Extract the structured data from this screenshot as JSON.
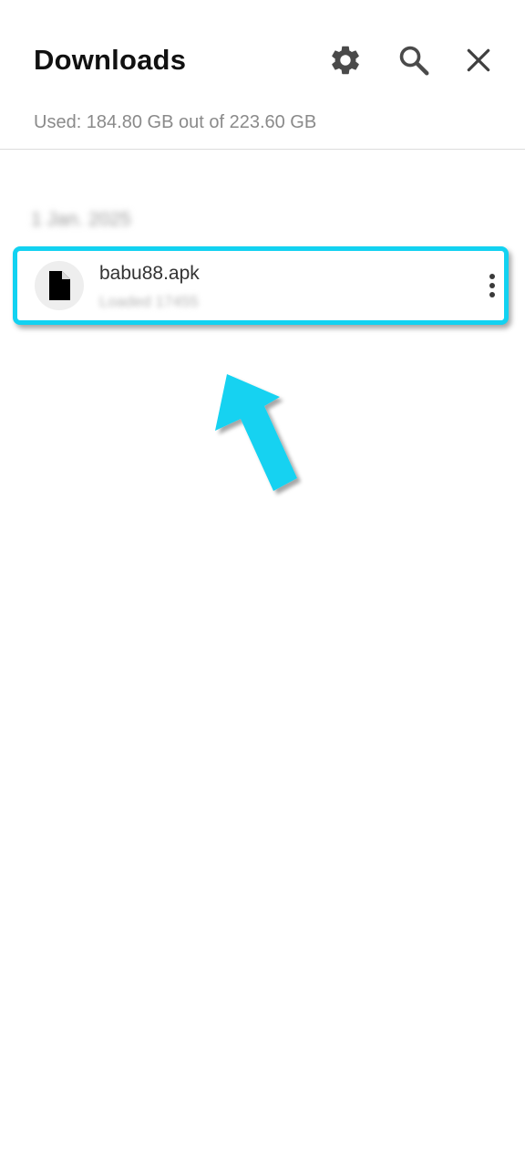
{
  "header": {
    "title": "Downloads",
    "storage_text": "Used: 184.80 GB out of 223.60 GB"
  },
  "icons": {
    "settings": "gear-icon",
    "search": "search-icon",
    "close": "close-icon",
    "file": "file-icon",
    "more": "more-vertical-icon",
    "annotation": "arrow-up-icon"
  },
  "downloads": {
    "date_label": "1 Jan. 2025",
    "items": [
      {
        "name": "babu88.apk",
        "meta": "Loaded 17455"
      }
    ]
  },
  "colors": {
    "highlight": "#12d2f1",
    "text_primary": "#111111",
    "text_secondary": "#8a8a8a"
  }
}
